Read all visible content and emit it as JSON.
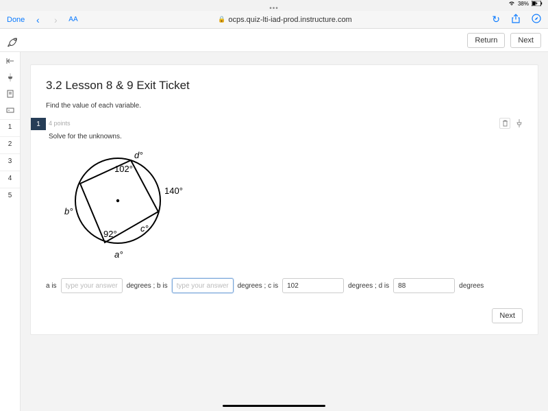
{
  "ios": {
    "battery": "38%"
  },
  "browser": {
    "done": "Done",
    "url": "ocps.quiz-lti-iad-prod.instructure.com"
  },
  "toolbar": {
    "return": "Return",
    "next": "Next"
  },
  "rail": {
    "nums": [
      "1",
      "2",
      "3",
      "4",
      "5"
    ]
  },
  "quiz": {
    "title": "3.2 Lesson 8 & 9 Exit Ticket",
    "instruction": "Find the value of each variable.",
    "q1": {
      "number": "1",
      "points": "4 points",
      "prompt": "Solve for the unknowns.",
      "labels": {
        "d": "d°",
        "a102": "102°",
        "arc140": "140°",
        "b": "b°",
        "a92": "92°",
        "c": "c°",
        "a": "a°"
      },
      "answers": {
        "a_lead": "a is",
        "a_ph": "type your answer...",
        "b_lead": "degrees ; b is",
        "b_ph": "type your answer...",
        "c_lead": "degrees ; c is",
        "c_val": "102",
        "d_lead": "degrees ; d is",
        "d_val": "88",
        "trail": "degrees"
      }
    },
    "footer_next": "Next"
  }
}
